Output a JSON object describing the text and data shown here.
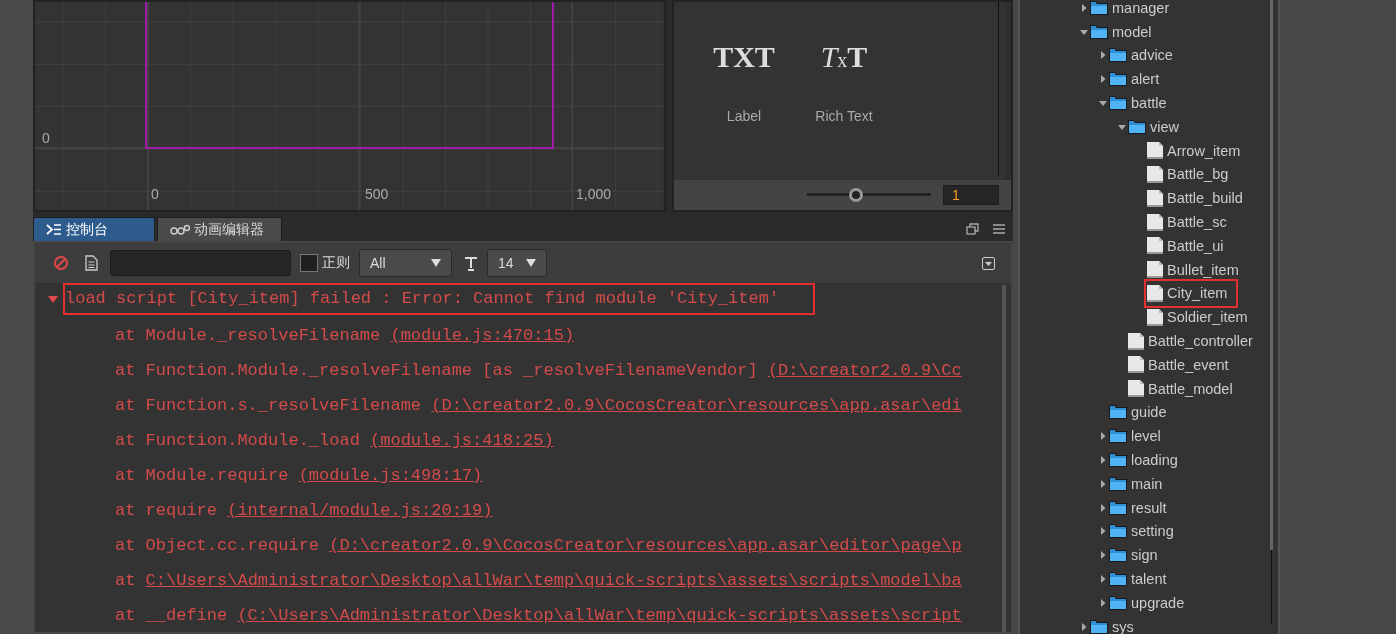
{
  "scene": {
    "y_label": "0",
    "x_labels": [
      "0",
      "500",
      "1,000"
    ]
  },
  "widgets": {
    "items": [
      {
        "icon": "TXT",
        "kind": "label",
        "label": "Label"
      },
      {
        "icon": "TxT",
        "kind": "richtext",
        "label": "Rich Text"
      }
    ],
    "zoom": {
      "level": 0.38,
      "value": "1"
    }
  },
  "console": {
    "tabs": [
      {
        "label": "控制台",
        "kind": "console",
        "selected": true
      },
      {
        "label": "动画编辑器",
        "kind": "animation",
        "selected": false
      }
    ],
    "regex": {
      "label": "正则",
      "checked": false
    },
    "level_select": "All",
    "font_size": "14",
    "log": {
      "message": "load script [City_item] failed : Error: Cannot find module 'City_item'",
      "expanded": true,
      "highlighted": true,
      "stack": [
        {
          "text": "at Module._resolveFilename",
          "location": "(module.js:470:15)"
        },
        {
          "text": "at Function.Module._resolveFilename [as _resolveFilenameVendor]",
          "location": "(D:\\creator2.0.9\\Cc"
        },
        {
          "text": "at Function.s._resolveFilename",
          "location": "(D:\\creator2.0.9\\CocosCreator\\resources\\app.asar\\edi"
        },
        {
          "text": "at Function.Module._load",
          "location": "(module.js:418:25)"
        },
        {
          "text": "at Module.require",
          "location": "(module.js:498:17)"
        },
        {
          "text": "at require",
          "location": "(internal/module.js:20:19)"
        },
        {
          "text": "at Object.cc.require",
          "location": "(D:\\creator2.0.9\\CocosCreator\\resources\\app.asar\\editor\\page\\p"
        },
        {
          "text": "at",
          "location": "C:\\Users\\Administrator\\Desktop\\allWar\\temp\\quick-scripts\\assets\\scripts\\model\\ba"
        },
        {
          "text": "at __define",
          "location": "(C:\\Users\\Administrator\\Desktop\\allWar\\temp\\quick-scripts\\assets\\script"
        }
      ]
    }
  },
  "assets": {
    "tree": [
      {
        "name": "manager",
        "kind": "folder",
        "expanded": false
      },
      {
        "name": "model",
        "kind": "folder",
        "expanded": true,
        "children": [
          {
            "name": "advice",
            "kind": "folder",
            "expanded": false
          },
          {
            "name": "alert",
            "kind": "folder",
            "expanded": false
          },
          {
            "name": "battle",
            "kind": "folder",
            "expanded": true,
            "children": [
              {
                "name": "view",
                "kind": "folder",
                "expanded": true,
                "children": [
                  {
                    "name": "Arrow_item",
                    "kind": "script"
                  },
                  {
                    "name": "Battle_bg",
                    "kind": "script"
                  },
                  {
                    "name": "Battle_build",
                    "kind": "script"
                  },
                  {
                    "name": "Battle_sc",
                    "kind": "script"
                  },
                  {
                    "name": "Battle_ui",
                    "kind": "script"
                  },
                  {
                    "name": "Bullet_item",
                    "kind": "script"
                  },
                  {
                    "name": "City_item",
                    "kind": "script",
                    "highlighted": true
                  },
                  {
                    "name": "Soldier_item",
                    "kind": "script"
                  }
                ]
              },
              {
                "name": "Battle_controller",
                "kind": "script"
              },
              {
                "name": "Battle_event",
                "kind": "script"
              },
              {
                "name": "Battle_model",
                "kind": "script"
              }
            ]
          },
          {
            "name": "guide",
            "kind": "folder"
          },
          {
            "name": "level",
            "kind": "folder",
            "expanded": false
          },
          {
            "name": "loading",
            "kind": "folder",
            "expanded": false
          },
          {
            "name": "main",
            "kind": "folder",
            "expanded": false
          },
          {
            "name": "result",
            "kind": "folder",
            "expanded": false
          },
          {
            "name": "setting",
            "kind": "folder",
            "expanded": false
          },
          {
            "name": "sign",
            "kind": "folder",
            "expanded": false
          },
          {
            "name": "talent",
            "kind": "folder",
            "expanded": false
          },
          {
            "name": "upgrade",
            "kind": "folder",
            "expanded": false
          }
        ]
      },
      {
        "name": "sys",
        "kind": "folder",
        "expanded": false
      }
    ]
  }
}
